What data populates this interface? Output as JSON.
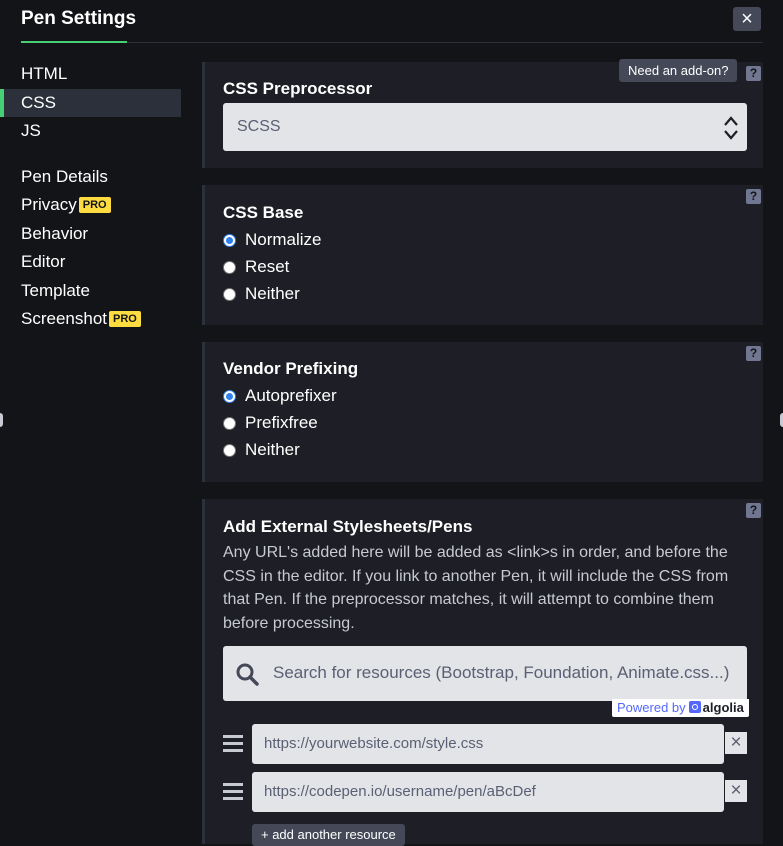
{
  "dialog": {
    "title": "Pen Settings",
    "close_icon": "×"
  },
  "sidebar": {
    "items": [
      {
        "label": "HTML",
        "active": false
      },
      {
        "label": "CSS",
        "active": true
      },
      {
        "label": "JS",
        "active": false
      },
      {
        "label": "Pen Details",
        "active": false
      },
      {
        "label": "Privacy",
        "badge": "PRO",
        "active": false
      },
      {
        "label": "Behavior",
        "active": false
      },
      {
        "label": "Editor",
        "active": false
      },
      {
        "label": "Template",
        "active": false
      },
      {
        "label": "Screenshot",
        "badge": "PRO",
        "active": false
      }
    ]
  },
  "preprocessor": {
    "addon_label": "Need an add-on?",
    "title": "CSS Preprocessor",
    "help": "?",
    "selected": "SCSS"
  },
  "css_base": {
    "title": "CSS Base",
    "help": "?",
    "options": [
      {
        "label": "Normalize",
        "checked": true
      },
      {
        "label": "Reset",
        "checked": false
      },
      {
        "label": "Neither",
        "checked": false
      }
    ]
  },
  "vendor": {
    "title": "Vendor Prefixing",
    "help": "?",
    "options": [
      {
        "label": "Autoprefixer",
        "checked": true
      },
      {
        "label": "Prefixfree",
        "checked": false
      },
      {
        "label": "Neither",
        "checked": false
      }
    ]
  },
  "external": {
    "title": "Add External Stylesheets/Pens",
    "help": "?",
    "description": "Any URL's added here will be added as <link>s in order, and before the CSS in the editor. If you link to another Pen, it will include the CSS from that Pen. If the preprocessor matches, it will attempt to combine them before processing.",
    "search_placeholder": "Search for resources (Bootstrap, Foundation, Animate.css...)",
    "powered_by": "Powered by",
    "powered_brand": "algolia",
    "resources": [
      {
        "placeholder": "https://yourwebsite.com/style.css",
        "remove": "×"
      },
      {
        "placeholder": "https://codepen.io/username/pen/aBcDef",
        "remove": "×"
      }
    ],
    "add_label": "+ add another resource"
  },
  "colors": {
    "background": "#131417",
    "panel": "#1e1f26",
    "accent_green": "#47cf73",
    "pro_yellow": "#ffdd40",
    "button_gray": "#444857",
    "input_bg": "#e3e4e8",
    "radio_blue": "#2f80ed"
  }
}
